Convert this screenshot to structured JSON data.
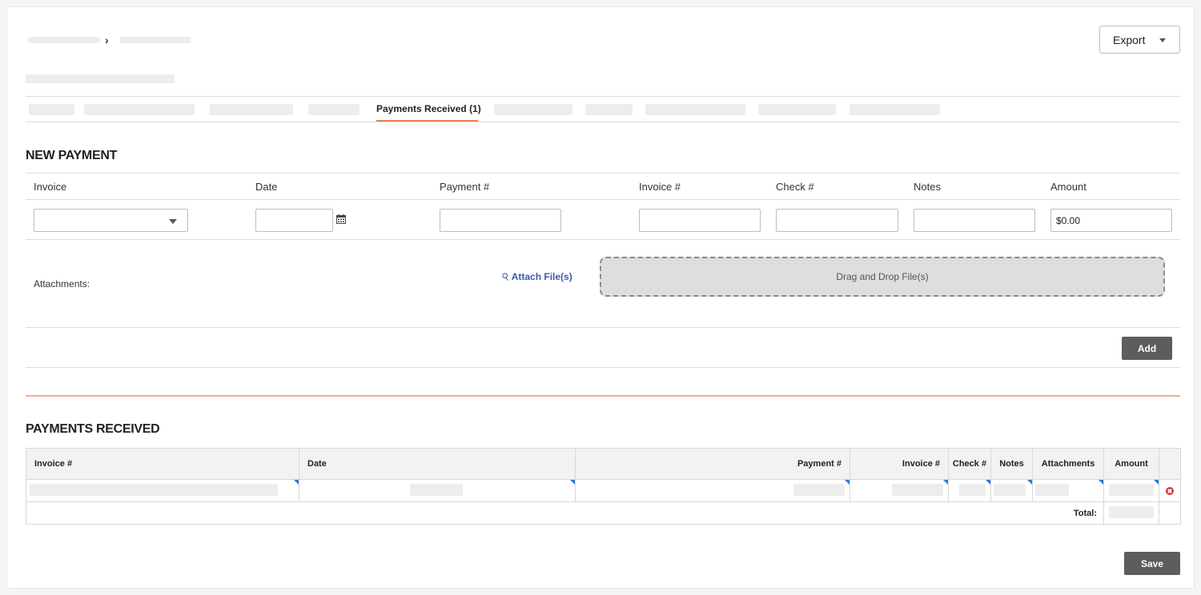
{
  "header": {
    "export_label": "Export"
  },
  "tabs": {
    "active_label": "Payments Received (1)"
  },
  "new_payment": {
    "title": "NEW PAYMENT",
    "columns": {
      "invoice": "Invoice",
      "date": "Date",
      "payment_no": "Payment #",
      "invoice_no": "Invoice #",
      "check_no": "Check #",
      "notes": "Notes",
      "amount": "Amount"
    },
    "amount_value": "$0.00",
    "attachments_label": "Attachments:",
    "attach_link": "Attach File(s)",
    "dropzone_text": "Drag and Drop File(s)",
    "add_label": "Add"
  },
  "payments_received": {
    "title": "PAYMENTS RECEIVED",
    "columns": [
      "Invoice #",
      "Date",
      "Payment #",
      "Invoice #",
      "Check #",
      "Notes",
      "Attachments",
      "Amount"
    ],
    "total_label": "Total:"
  },
  "footer": {
    "save_label": "Save"
  },
  "colors": {
    "accent": "#e8834f",
    "link": "#3b5bb0",
    "button": "#5d5d5d",
    "delete": "#d9342b",
    "cell_marker": "#2b7bd6"
  }
}
